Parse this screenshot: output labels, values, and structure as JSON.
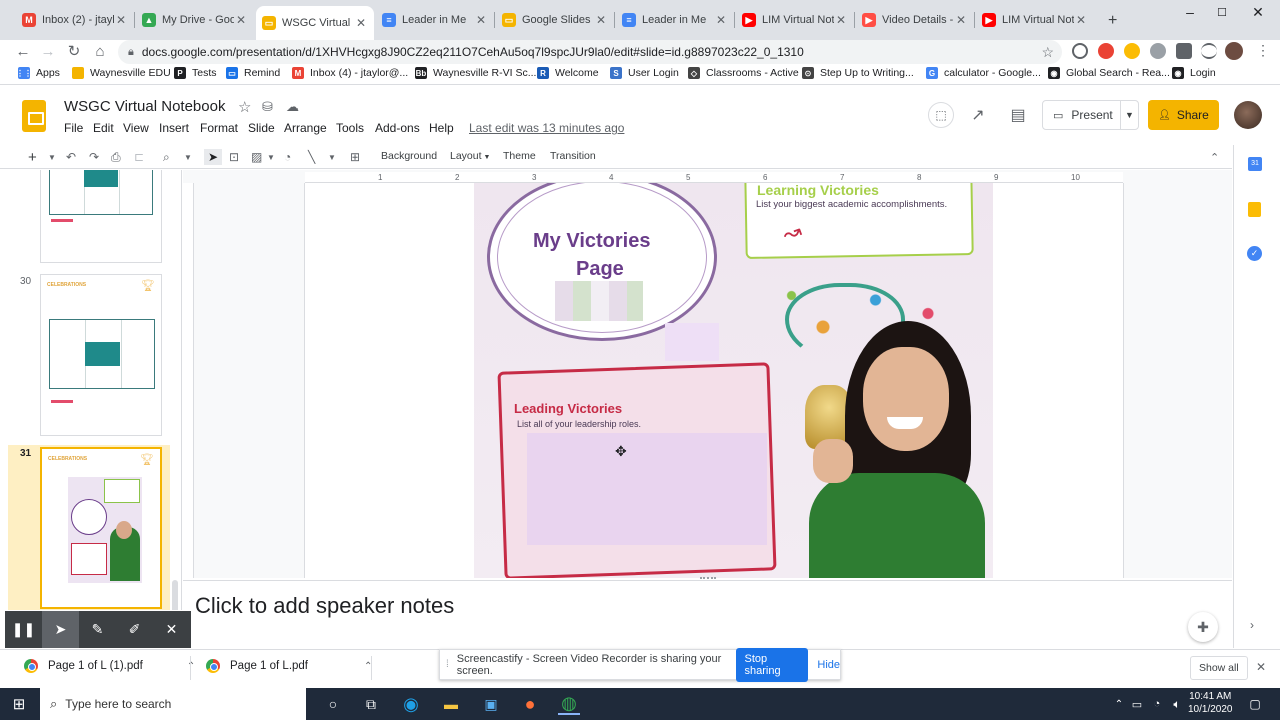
{
  "browser": {
    "tabs": [
      {
        "title": "Inbox (2) - jtaylo",
        "icon": "gmail-icon",
        "color": "#ea4335",
        "glyph": "M"
      },
      {
        "title": "My Drive - Goog",
        "icon": "drive-icon",
        "color": "#34a853",
        "glyph": "▲"
      },
      {
        "title": "WSGC Virtual N",
        "icon": "slides-icon",
        "color": "#f4b400",
        "glyph": "▭"
      },
      {
        "title": "Leader in Me",
        "icon": "doc-icon",
        "color": "#4285f4",
        "glyph": "≡"
      },
      {
        "title": "Google Slides",
        "icon": "slides-icon",
        "color": "#f4b400",
        "glyph": "▭"
      },
      {
        "title": "Leader in Me",
        "icon": "doc-icon",
        "color": "#4285f4",
        "glyph": "≡"
      },
      {
        "title": "LIM Virtual Note",
        "icon": "youtube-icon",
        "color": "#ff0000",
        "glyph": "▶"
      },
      {
        "title": "Video Details - S",
        "icon": "youtube-studio-icon",
        "color": "#ff4e45",
        "glyph": "▶"
      },
      {
        "title": "LIM Virtual Note",
        "icon": "youtube-icon",
        "color": "#ff0000",
        "glyph": "▶"
      }
    ],
    "new_tab": "+",
    "url": "docs.google.com/presentation/d/1XHVHcgxg8J90CZ2eq211O7CehAu5oq7l9spcJUr9la0/edit#slide=id.g8897023c22_0_1310",
    "bookmarks": [
      {
        "label": "Apps",
        "color": "#4285f4",
        "glyph": "⋮⋮"
      },
      {
        "label": "Waynesville EDU",
        "color": "#f4b400",
        "glyph": ""
      },
      {
        "label": "Tests",
        "color": "#202124",
        "glyph": "P"
      },
      {
        "label": "Remind",
        "color": "#1a73e8",
        "glyph": "▭"
      },
      {
        "label": "Inbox (4) - jtaylor@...",
        "color": "#ea4335",
        "glyph": "M"
      },
      {
        "label": "Waynesville R-VI Sc...",
        "color": "#202124",
        "glyph": "Bb"
      },
      {
        "label": "Welcome",
        "color": "#1a5bb5",
        "glyph": "R"
      },
      {
        "label": "User Login",
        "color": "#3b73c9",
        "glyph": "S"
      },
      {
        "label": "Classrooms - Active",
        "color": "#444",
        "glyph": "◇"
      },
      {
        "label": "Step Up to Writing...",
        "color": "#444",
        "glyph": "⊙"
      },
      {
        "label": "calculator - Google...",
        "color": "#4285f4",
        "glyph": "G"
      },
      {
        "label": "Global Search - Rea...",
        "color": "#202124",
        "glyph": "◉"
      },
      {
        "label": "Login",
        "color": "#202124",
        "glyph": "◉"
      }
    ]
  },
  "slides": {
    "title": "WSGC  Virtual Notebook",
    "menu": [
      "File",
      "Edit",
      "View",
      "Insert",
      "Format",
      "Slide",
      "Arrange",
      "Tools",
      "Add-ons",
      "Help"
    ],
    "last_edit": "Last edit was 13 minutes ago",
    "present_label": "Present",
    "share_label": "Share",
    "toolbar": {
      "background": "Background",
      "layout": "Layout",
      "theme": "Theme",
      "transition": "Transition"
    },
    "ruler_numbers": [
      "1",
      "2",
      "3",
      "4",
      "5",
      "6",
      "7",
      "8",
      "9",
      "10"
    ],
    "filmstrip": [
      {
        "number": "30",
        "heading": "CELEBRATIONS"
      },
      {
        "number": "31",
        "heading": "CELEBRATIONS"
      }
    ],
    "slide": {
      "learning_title": "Learning Victories",
      "learning_sub": "List your biggest academic accomplishments.",
      "victories_title": "My Victories",
      "victories_page": "Page",
      "leading_title": "Leading Victories",
      "leading_sub": "List all of your leadership roles."
    },
    "speaker_notes_placeholder": "Click to add speaker notes"
  },
  "downloads": [
    {
      "name": "Page 1 of L (1).pdf"
    },
    {
      "name": "Page 1 of L.pdf"
    }
  ],
  "downloads_show_all": "Show all",
  "screencastify": {
    "message": "Screencastify - Screen Video Recorder is sharing your screen.",
    "stop_label": "Stop sharing",
    "hide_label": "Hide"
  },
  "taskbar": {
    "search_placeholder": "Type here to search",
    "time": "10:41 AM",
    "date": "10/1/2020"
  },
  "colors": {
    "slides_yellow": "#f4b400",
    "link_blue": "#1a73e8",
    "purple_text": "#6a3d8a",
    "green_text": "#8bc34a",
    "leading_red": "#c62b46"
  }
}
